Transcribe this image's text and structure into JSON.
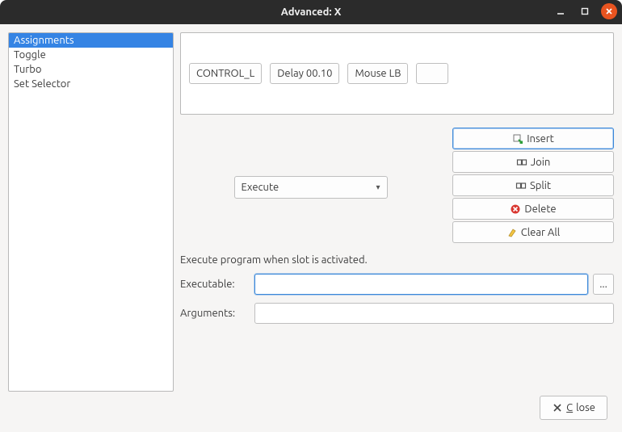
{
  "window": {
    "title": "Advanced: X"
  },
  "sidebar": {
    "items": [
      {
        "label": "Assignments",
        "selected": true
      },
      {
        "label": "Toggle",
        "selected": false
      },
      {
        "label": "Turbo",
        "selected": false
      },
      {
        "label": "Set Selector",
        "selected": false
      }
    ]
  },
  "slots": [
    {
      "label": "CONTROL_L"
    },
    {
      "label": "Delay 00.10"
    },
    {
      "label": "Mouse LB"
    },
    {
      "label": ""
    }
  ],
  "action_type": {
    "selected": "Execute"
  },
  "buttons": {
    "insert": "Insert",
    "join": "Join",
    "split": "Split",
    "delete": "Delete",
    "clear_all": "Clear All"
  },
  "description": "Execute program when slot is activated.",
  "form": {
    "executable_label": "Executable:",
    "executable_value": "",
    "arguments_label": "Arguments:",
    "arguments_value": "",
    "browse_label": "..."
  },
  "footer": {
    "close_label": "Close"
  }
}
